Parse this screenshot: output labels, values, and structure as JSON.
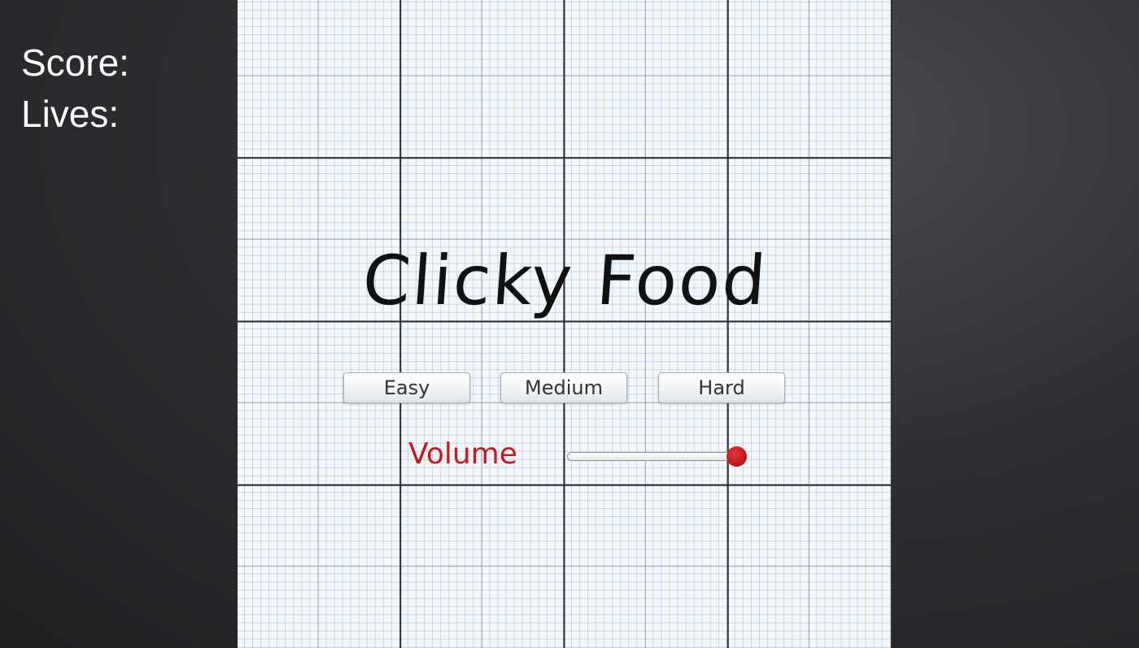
{
  "hud": {
    "score_label": "Score:",
    "lives_label": "Lives:"
  },
  "menu": {
    "title": "Clicky Food",
    "difficulty": {
      "easy": "Easy",
      "medium": "Medium",
      "hard": "Hard"
    },
    "volume": {
      "label": "Volume",
      "value": 1.0
    }
  },
  "colors": {
    "accent_red": "#c41a1f",
    "title_text": "#111111",
    "hud_text": "#ffffff"
  }
}
